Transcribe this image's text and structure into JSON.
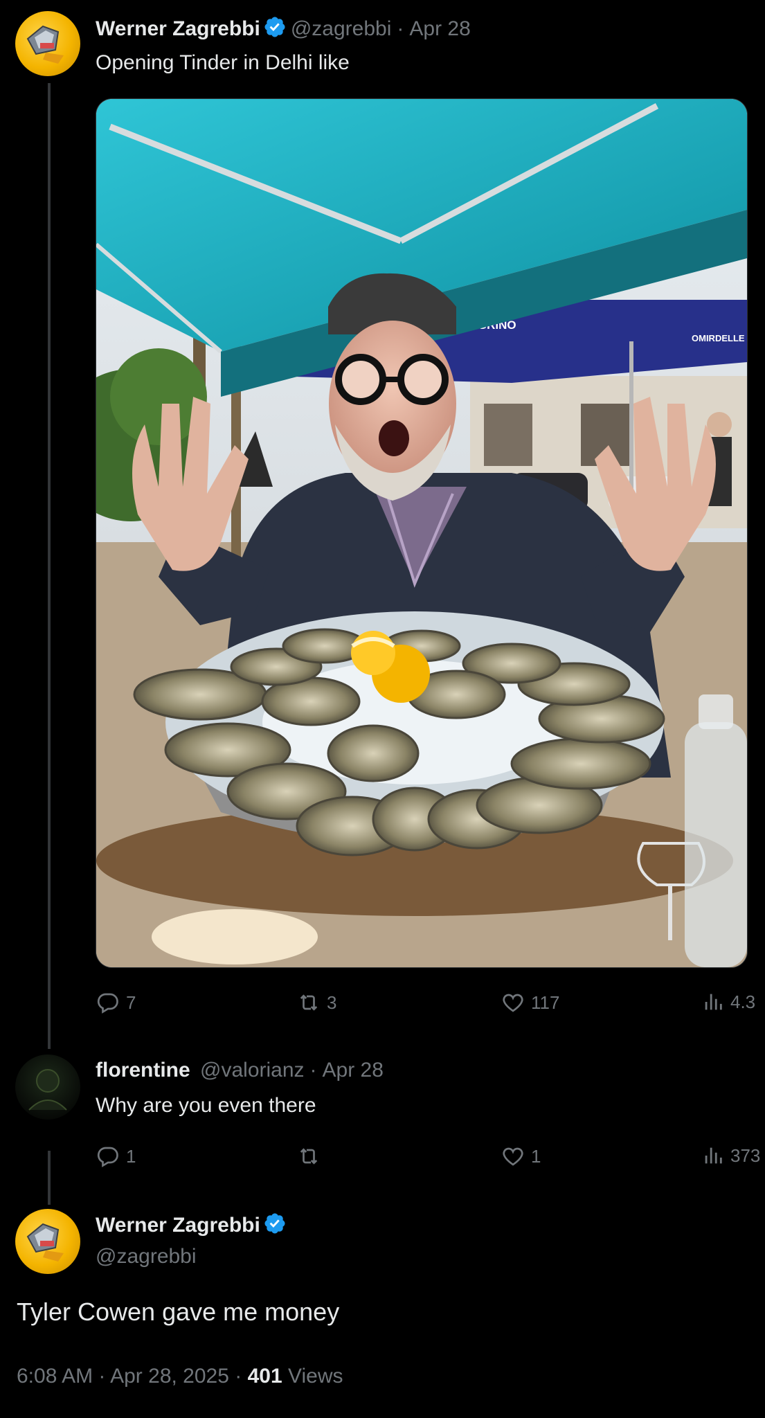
{
  "tweet1": {
    "author_name": "Werner Zagrebbi",
    "handle": "@zagrebbi",
    "separator": "·",
    "date": "Apr 28",
    "text": "Opening Tinder in Delhi like",
    "image_text": {
      "umbrella_brand": "S.PELLEGRINO",
      "umbrella_brand_mirrored": "OMIRDELLE"
    },
    "stats": {
      "replies": "7",
      "reposts": "3",
      "likes": "117",
      "views": "4.3"
    }
  },
  "reply": {
    "author_name": "florentine",
    "handle": "@valorianz",
    "separator": "·",
    "date": "Apr 28",
    "text": "Why are you even there",
    "stats": {
      "replies": "1",
      "reposts": "",
      "likes": "1",
      "views": "373"
    }
  },
  "main_tweet": {
    "author_name": "Werner Zagrebbi",
    "handle": "@zagrebbi",
    "text": "Tyler Cowen gave me money",
    "time": "6:08 AM",
    "date": "Apr 28, 2025",
    "separator": "·",
    "views_count": "401",
    "views_label": "Views"
  },
  "colors": {
    "background": "#000000",
    "text": "#e7e9ea",
    "muted": "#71767b",
    "verified": "#1d9bf0",
    "thread_line": "#333639"
  },
  "icons": [
    "reply-icon",
    "repost-icon",
    "like-icon",
    "views-icon",
    "verified-badge-icon"
  ]
}
